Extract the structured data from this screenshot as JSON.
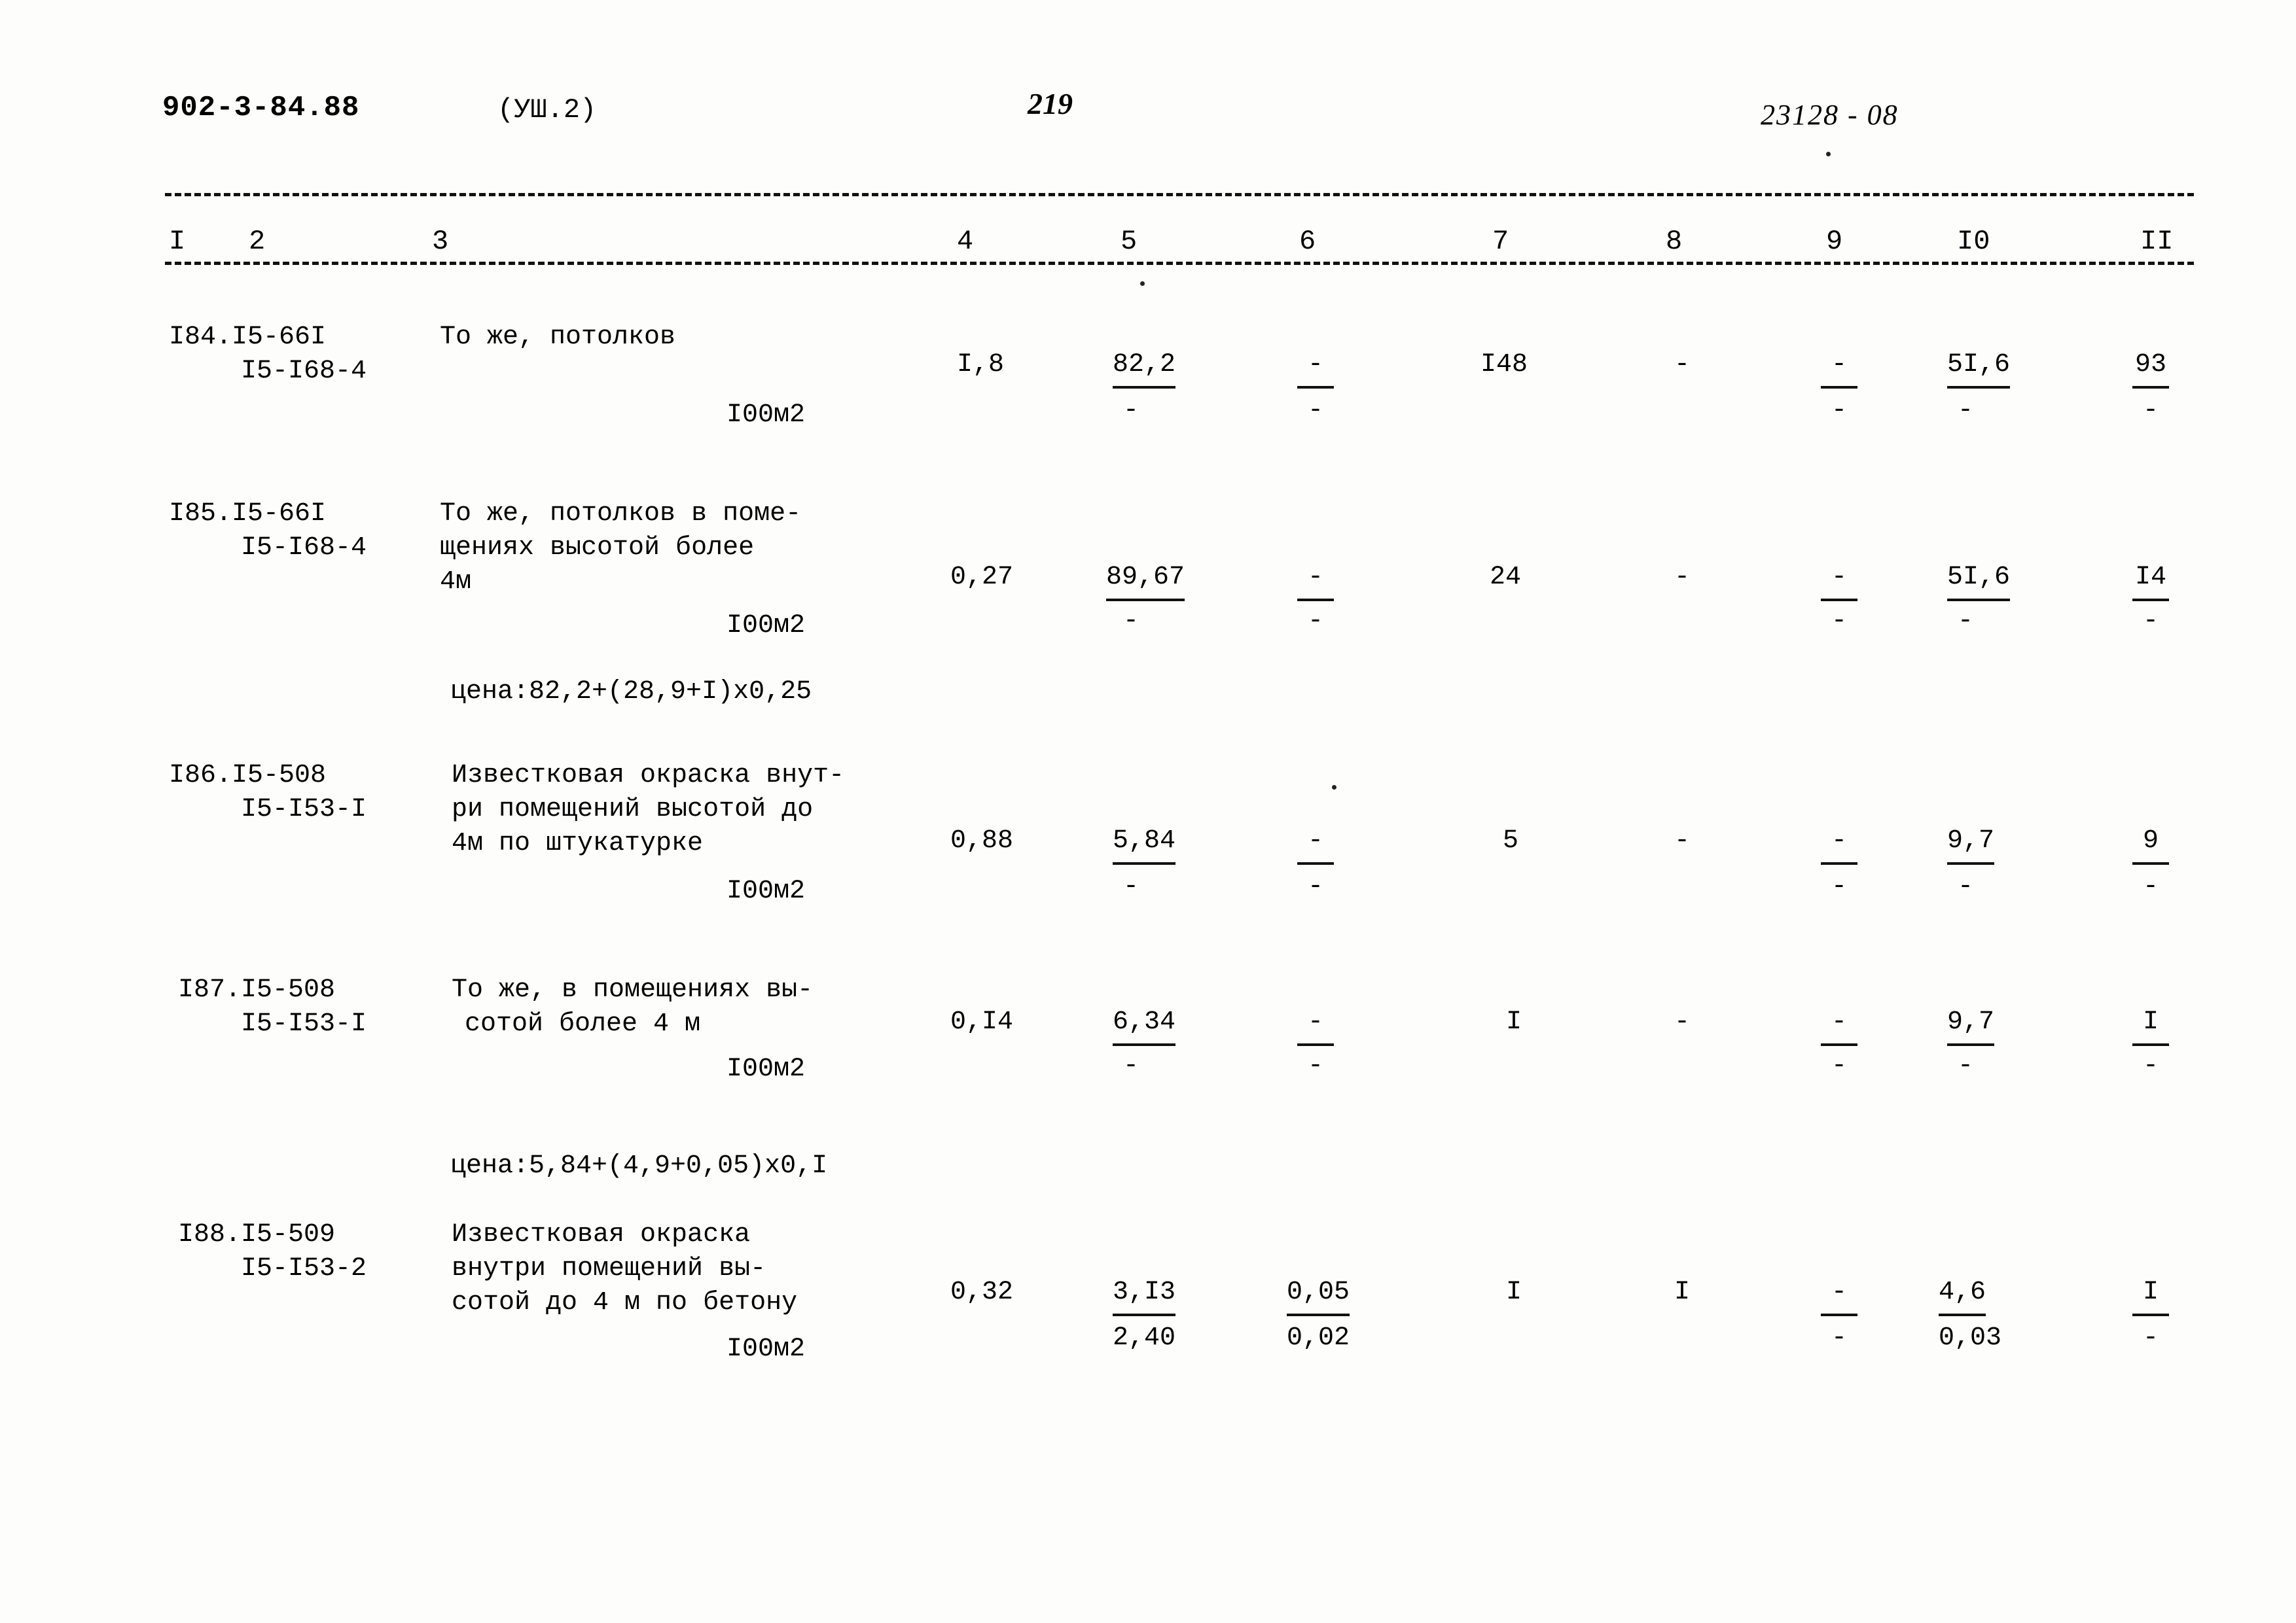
{
  "header": {
    "document_code": "902-3-84.88",
    "section": "(УШ.2)",
    "page_number": "219",
    "archive_code": "23128 - 08"
  },
  "table": {
    "column_numbers": [
      "I",
      "2",
      "3",
      "4",
      "5",
      "6",
      "7",
      "8",
      "9",
      "I0",
      "II"
    ],
    "rows": [
      {
        "index_line1": "I84.I5-66I",
        "index_line2": "I5-I68-4",
        "description": [
          "То же, потолков"
        ],
        "unit": "I00м2",
        "c4": "I,8",
        "c5a": "82,2",
        "c5b": "-",
        "c6a": "-",
        "c6b": "-",
        "c7": "I48",
        "c8": "-",
        "c9a": "-",
        "c9b": "-",
        "c10a": "5I,6",
        "c10b": "-",
        "c11a": "93",
        "c11b": "-"
      },
      {
        "index_line1": "I85.I5-66I",
        "index_line2": "I5-I68-4",
        "description": [
          "То же, потолков в поме-",
          "щениях высотой более",
          "4м"
        ],
        "unit": "I00м2",
        "c4": "0,27",
        "c5a": "89,67",
        "c5b": "-",
        "c6a": "-",
        "c6b": "-",
        "c7": "24",
        "c8": "-",
        "c9a": "-",
        "c9b": "-",
        "c10a": "5I,6",
        "c10b": "-",
        "c11a": "I4",
        "c11b": "-"
      },
      {
        "index_line1": "I86.I5-508",
        "index_line2": "I5-I53-I",
        "description": [
          "Известковая окраска внут-",
          "ри помещений высотой до",
          "4м по штукатурке"
        ],
        "unit": "I00м2",
        "c4": "0,88",
        "c5a": "5,84",
        "c5b": "-",
        "c6a": "-",
        "c6b": "-",
        "c7": "5",
        "c8": "-",
        "c9a": "-",
        "c9b": "-",
        "c10a": "9,7",
        "c10b": "-",
        "c11a": "9",
        "c11b": "-"
      },
      {
        "index_line1": "I87.I5-508",
        "index_line2": "I5-I53-I",
        "description": [
          "То же, в помещениях вы-",
          "сотой более 4 м"
        ],
        "unit": "I00м2",
        "c4": "0,I4",
        "c5a": "6,34",
        "c5b": "-",
        "c6a": "-",
        "c6b": "-",
        "c7": "I",
        "c8": "-",
        "c9a": "-",
        "c9b": "-",
        "c10a": "9,7",
        "c10b": "-",
        "c11a": "I",
        "c11b": "-"
      },
      {
        "index_line1": "I88.I5-509",
        "index_line2": "I5-I53-2",
        "description": [
          "Известковая окраска",
          "внутри помещений вы-",
          "сотой до 4 м по бетону"
        ],
        "unit": "I00м2",
        "c4": "0,32",
        "c5a": "3,I3",
        "c5b": "2,40",
        "c6a": "0,05",
        "c6b": "0,02",
        "c7": "I",
        "c8": "I",
        "c9a": "-",
        "c9b": "-",
        "c10a": "4,6",
        "c10b": "0,03",
        "c11a": "I",
        "c11b": "-"
      }
    ],
    "price_notes": [
      "цена:82,2+(28,9+I)х0,25",
      "цена:5,84+(4,9+0,05)х0,I"
    ]
  }
}
